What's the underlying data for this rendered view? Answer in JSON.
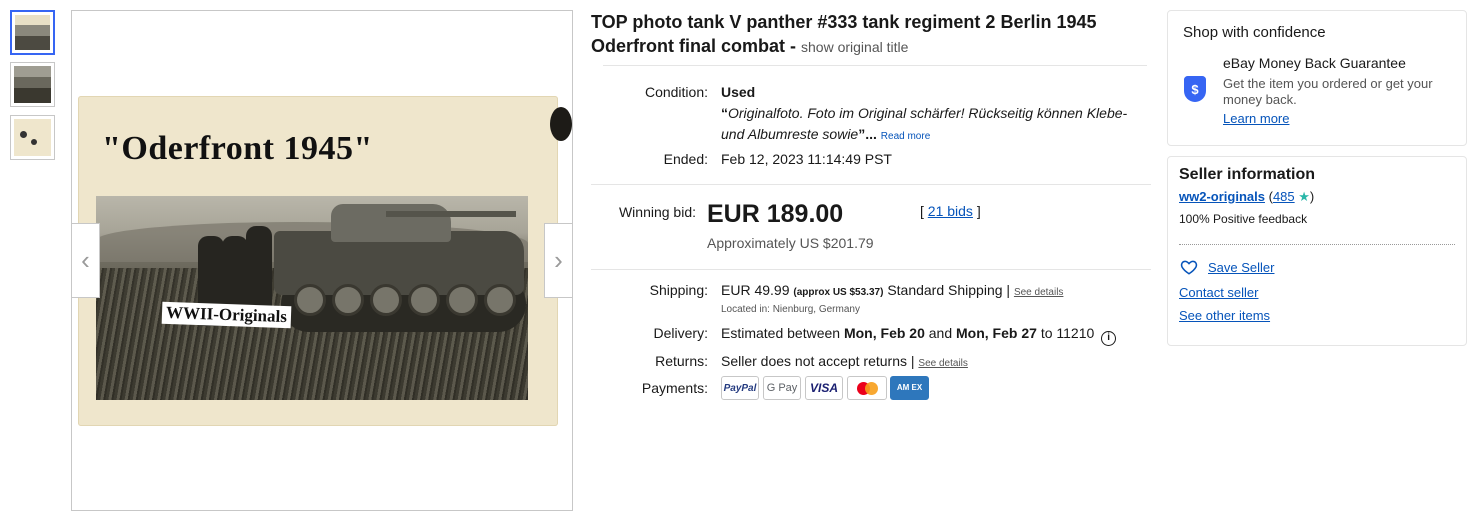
{
  "gallery": {
    "thumbnails": [
      "thumb-1",
      "thumb-2",
      "thumb-3"
    ],
    "photo_title": "\"Oderfront 1945\"",
    "photo_label": "WWII-Originals",
    "prev_icon": "chevron-left-icon",
    "next_icon": "chevron-right-icon"
  },
  "listing": {
    "title": "TOP photo tank V panther #333 tank regiment 2 Berlin 1945 Oderfront final combat - ",
    "show_original": "show original title",
    "condition_label": "Condition:",
    "condition_value": "Used",
    "condition_quote_open": "“",
    "condition_desc": "Originalfoto. Foto im Original schärfer! Rückseitig können Klebe- und Albumreste sowie",
    "condition_quote_close": "”...",
    "read_more": "Read more",
    "ended_label": "Ended:",
    "ended_value": "Feb 12, 2023 11:14:49 PST",
    "winning_bid_label": "Winning bid:",
    "winning_bid": "EUR 189.00",
    "approx_price": "Approximately US $201.79",
    "bids_open": "[ ",
    "bids": "21 bids",
    "bids_close": " ]",
    "shipping_label": "Shipping:",
    "shipping_price": "EUR 49.99",
    "shipping_approx": "(approx US $53.37)",
    "shipping_method": "Standard Shipping |",
    "see_details": "See details",
    "located": "Located in: Nienburg, Germany",
    "delivery_label": "Delivery:",
    "delivery_prefix": "Estimated between",
    "delivery_from": "Mon, Feb 20",
    "delivery_and": "and",
    "delivery_to": "Mon, Feb 27",
    "delivery_zip": "to 11210",
    "returns_label": "Returns:",
    "returns_value": "Seller does not accept returns |",
    "returns_details": "See details",
    "payments_label": "Payments:",
    "payments": [
      "PayPal",
      "G Pay",
      "VISA",
      "",
      "AM EX"
    ]
  },
  "confidence": {
    "heading": "Shop with confidence",
    "guarantee_title": "eBay Money Back Guarantee",
    "guarantee_text": "Get the item you ordered or get your money back.",
    "learn_more": "Learn more"
  },
  "seller": {
    "heading": "Seller information",
    "name": "ww2-originals",
    "feedback_open": "(",
    "feedback_count": "485",
    "feedback_close": ")",
    "positive": "100% Positive feedback",
    "save_seller": "Save Seller",
    "contact": "Contact seller",
    "other_items": "See other items"
  },
  "colors": {
    "link_blue": "#0654ba",
    "accent_blue": "#3665f3",
    "star_teal": "#2ab7a9"
  }
}
